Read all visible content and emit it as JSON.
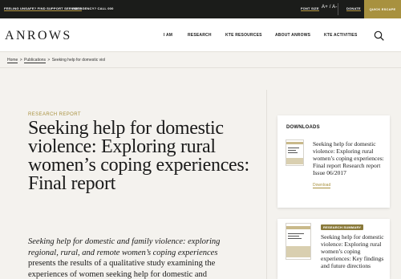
{
  "topbar": {
    "helpline": "FEELING UNSAFE? FIND SUPPORT SERVICES",
    "emergency": "EMERGENCY? CALL 000",
    "font_size": "FONT SIZE",
    "font_size_controls": "A+ / A-",
    "donate": "DONATE",
    "quick_exit": "QUICK ESCAPE"
  },
  "header": {
    "logo": "ANROWS",
    "nav": [
      "I AM",
      "RESEARCH",
      "KTE RESOURCES",
      "ABOUT ANROWS",
      "KTE ACTIVITIES"
    ],
    "search_icon": "search-icon"
  },
  "breadcrumb": {
    "home": "Home",
    "separator": ">",
    "publications": "Publications",
    "current": "Seeking help for domestic viol"
  },
  "article": {
    "category": "RESEARCH REPORT",
    "title": "Seeking help for domestic violence: Exploring rural women’s coping experiences: Final report",
    "intro_italic": "Seeking help for domestic and family violence: exploring regional, rural, and remote women’s coping experiences",
    "intro_text": " presents the results of a qualitative study examining the experiences of women seeking help for domestic and"
  },
  "sidebar": {
    "downloads_heading": "DOWNLOADS",
    "download_title": "Seeking help for domestic violence: Exploring rural women’s coping experiences: Final report Research report Issue 06/2017",
    "download_link": "Download",
    "summary_badge": "RESEARCH SUMMARY",
    "summary_title": "Seeking help for domestic violence: Exploring rural women’s coping experiences: Key findings and future directions"
  },
  "colors": {
    "accent": "#a8913f",
    "topbar": "#1b1c1a",
    "background": "#f4f2ee"
  }
}
